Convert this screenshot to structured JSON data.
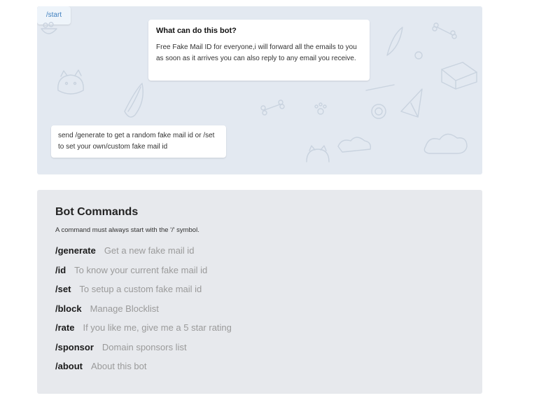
{
  "chat": {
    "info_title": "What can do this bot?",
    "info_text": "Free Fake Mail ID for everyone,i will forward all the emails to you as soon as it arrives you can also reply to any email you receive.",
    "start_button": "/start",
    "bot_reply": "send /generate to get a random fake mail id or /set to set your own/custom fake mail id"
  },
  "commands": {
    "heading": "Bot Commands",
    "subtitle": "A command must always start with the '/' symbol.",
    "items": [
      {
        "name": "/generate",
        "desc": "Get a new fake mail id"
      },
      {
        "name": "/id",
        "desc": "To know your current fake mail id"
      },
      {
        "name": "/set",
        "desc": "To setup a custom fake mail id"
      },
      {
        "name": "/block",
        "desc": "Manage Blocklist"
      },
      {
        "name": "/rate",
        "desc": "If you like me, give me a 5 star rating"
      },
      {
        "name": "/sponsor",
        "desc": "Domain sponsors list"
      },
      {
        "name": "/about",
        "desc": "About this bot"
      }
    ]
  },
  "colors": {
    "chat_background": "#e3e9f1",
    "panel_background": "#e7e9ed",
    "start_text": "#3f7fbf"
  },
  "icons": [
    "cat-doodle",
    "bone-doodle",
    "paw-doodle",
    "bowl-doodle",
    "cake-doodle",
    "paper-plane-doodle",
    "leaf-doodle"
  ]
}
